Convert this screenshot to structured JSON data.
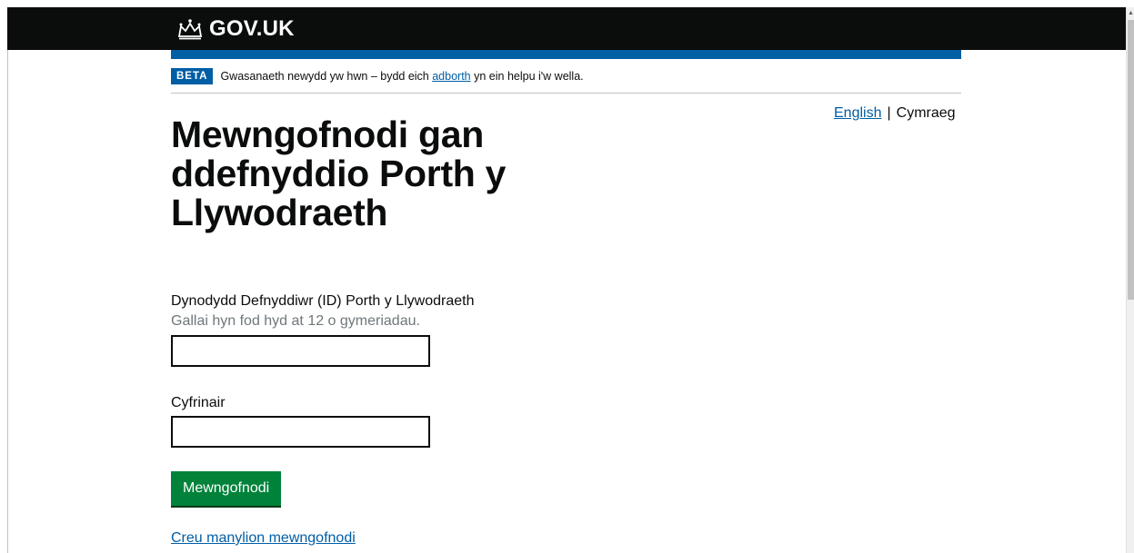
{
  "header": {
    "logo_text": "GOV.UK"
  },
  "phase_banner": {
    "tag": "BETA",
    "text_before": "Gwasanaeth newydd yw hwn – bydd eich ",
    "link": "adborth",
    "text_after": " yn ein helpu i'w wella."
  },
  "language": {
    "english": "English",
    "separator": "|",
    "current": "Cymraeg"
  },
  "page": {
    "title": "Mewngofnodi gan ddefnyddio Porth y Llywodraeth"
  },
  "form": {
    "user_id_label": "Dynodydd Defnyddiwr (ID) Porth y Llywodraeth",
    "user_id_hint": "Gallai hyn fod hyd at 12 o gymeriadau.",
    "user_id_value": "",
    "password_label": "Cyfrinair",
    "password_value": "",
    "submit_label": "Mewngofnodi",
    "create_link": "Creu manylion mewngofnodi"
  },
  "colors": {
    "header_bg": "#0b0c0c",
    "brand_blue": "#005ea5",
    "button_green": "#00823b",
    "hint_grey": "#6f777b"
  }
}
